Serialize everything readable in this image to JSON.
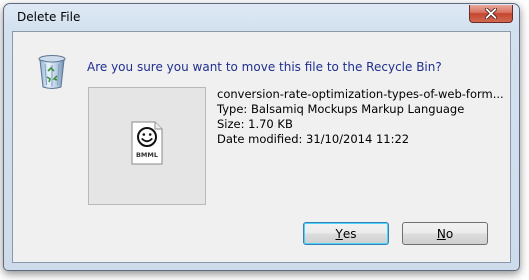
{
  "window": {
    "title": "Delete File"
  },
  "dialog": {
    "question": "Are you sure you want to move this file to the Recycle Bin?",
    "file_icon_label": "BMML"
  },
  "file": {
    "name": "conversion-rate-optimization-types-of-web-form...",
    "type": "Type: Balsamiq Mockups Markup Language",
    "size": "Size: 1.70 KB",
    "date_modified": "Date modified: 31/10/2014 11:22"
  },
  "buttons": {
    "yes_mnemonic": "Y",
    "yes_rest": "es",
    "no_mnemonic": "N",
    "no_rest": "o"
  },
  "icons": {
    "close": "close-icon",
    "recycle_bin": "recycle-bin-icon",
    "file": "bmml-file-icon"
  },
  "colors": {
    "question_text": "#1f2f8f",
    "close_button": "#c5452f",
    "default_button_border": "#3c7fb1"
  }
}
